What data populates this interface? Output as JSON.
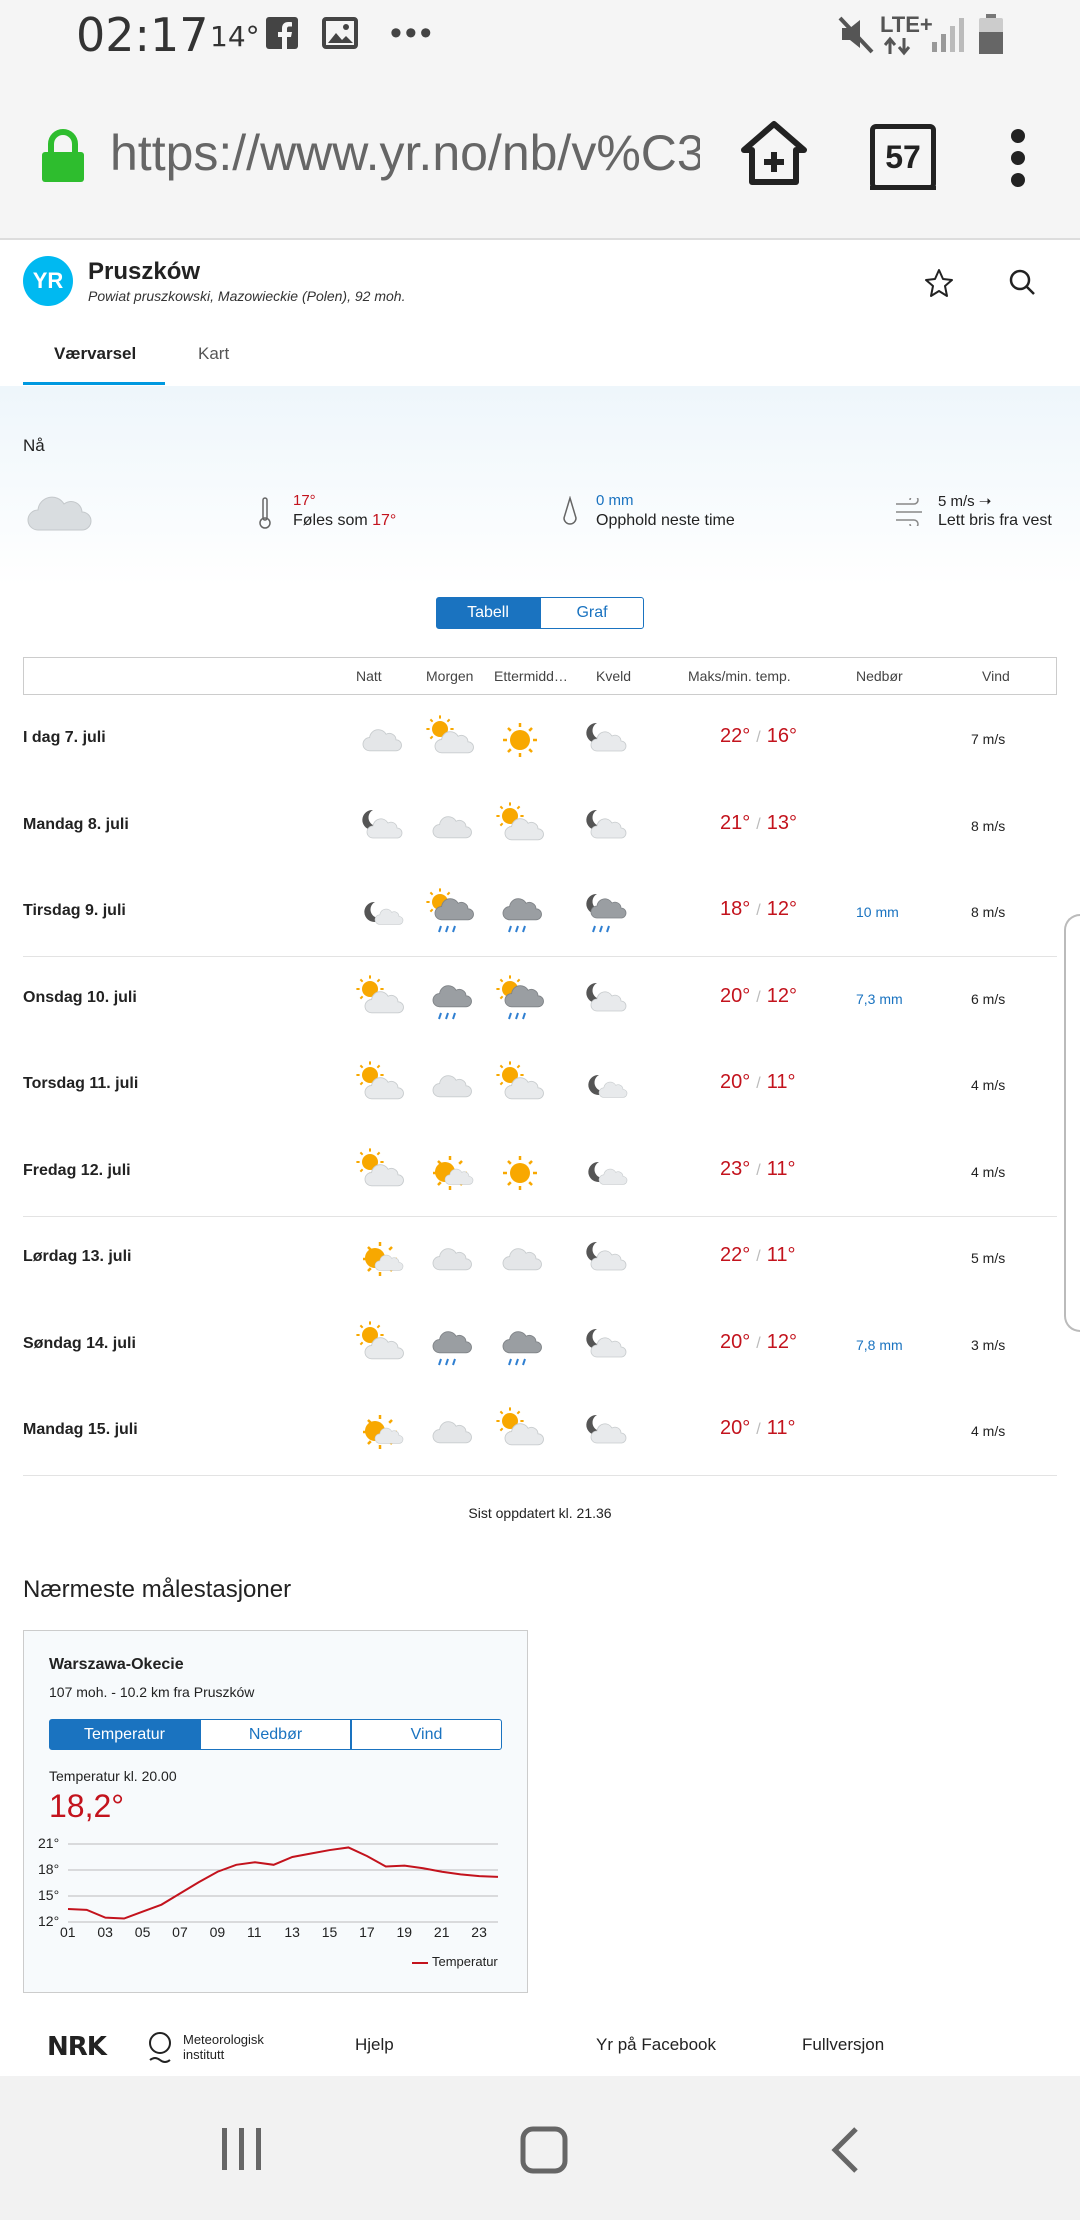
{
  "status_bar": {
    "time": "02:17",
    "temperature": "14°",
    "network": "LTE+"
  },
  "browser": {
    "url": "https://www.yr.no/nb/v%C3",
    "tab_count": "57"
  },
  "header": {
    "logo": "YR",
    "location": "Pruszków",
    "subtitle": "Powiat pruszkowski, Mazowieckie (Polen), 92 moh."
  },
  "tabs": {
    "forecast": "Værvarsel",
    "map": "Kart"
  },
  "now": {
    "label": "Nå",
    "temp": "17°",
    "feels_prefix": "Føles som",
    "feels_value": "17°",
    "precip": "0 mm",
    "precip_text": "Opphold neste time",
    "wind": "5 m/s",
    "wind_text": "Lett bris fra vest"
  },
  "view_toggle": {
    "table": "Tabell",
    "graph": "Graf",
    "selected": "Tabell"
  },
  "table": {
    "headers": {
      "night": "Natt",
      "morning": "Morgen",
      "afternoon": "Ettermidd…",
      "evening": "Kveld",
      "maxmin": "Maks/min. temp.",
      "precip": "Nedbør",
      "wind": "Vind"
    },
    "rows": [
      {
        "day": "I dag 7. juli",
        "icons": [
          "cloud",
          "partly-sunny",
          "sun",
          "moon-cloud"
        ],
        "max": "22°",
        "min": "16°",
        "precip": "",
        "wind": "7 m/s"
      },
      {
        "day": "Mandag 8. juli",
        "icons": [
          "moon-cloud",
          "cloud",
          "partly-sunny",
          "moon-cloud"
        ],
        "max": "21°",
        "min": "13°",
        "precip": "",
        "wind": "8 m/s"
      },
      {
        "day": "Tirsdag 9. juli",
        "icons": [
          "moon-partly",
          "sun-rain",
          "rain-cloud",
          "moon-rain"
        ],
        "max": "18°",
        "min": "12°",
        "precip": "10 mm",
        "wind": "8 m/s"
      },
      {
        "day": "Onsdag 10. juli",
        "icons": [
          "partly-sunny",
          "rain-cloud",
          "sun-rain",
          "moon-cloud"
        ],
        "max": "20°",
        "min": "12°",
        "precip": "7,3 mm",
        "wind": "6 m/s"
      },
      {
        "day": "Torsdag 11. juli",
        "icons": [
          "partly-sunny",
          "cloud",
          "partly-sunny",
          "moon-partly"
        ],
        "max": "20°",
        "min": "11°",
        "precip": "",
        "wind": "4 m/s"
      },
      {
        "day": "Fredag 12. juli",
        "icons": [
          "partly-sunny",
          "sun-partly",
          "sun",
          "moon-partly"
        ],
        "max": "23°",
        "min": "11°",
        "precip": "",
        "wind": "4 m/s"
      },
      {
        "day": "Lørdag 13. juli",
        "icons": [
          "sun-partly",
          "cloud",
          "cloud",
          "moon-cloud"
        ],
        "max": "22°",
        "min": "11°",
        "precip": "",
        "wind": "5 m/s"
      },
      {
        "day": "Søndag 14. juli",
        "icons": [
          "partly-sunny",
          "rain-cloud",
          "rain-cloud",
          "moon-cloud"
        ],
        "max": "20°",
        "min": "12°",
        "precip": "7,8 mm",
        "wind": "3 m/s"
      },
      {
        "day": "Mandag 15. juli",
        "icons": [
          "sun-partly",
          "cloud",
          "partly-sunny",
          "moon-cloud"
        ],
        "max": "20°",
        "min": "11°",
        "precip": "",
        "wind": "4 m/s"
      }
    ]
  },
  "updated": "Sist oppdatert kl. 21.36",
  "stations": {
    "heading": "Nærmeste målestasjoner",
    "name": "Warszawa-Okecie",
    "subtitle": "107 moh. - 10.2 km fra Pruszków",
    "tabs": [
      "Temperatur",
      "Nedbør",
      "Vind"
    ],
    "selected_tab": "Temperatur",
    "temp_label": "Temperatur kl. 20.00",
    "temp_value": "18,2°"
  },
  "chart_data": {
    "type": "line",
    "x": [
      "01",
      "02",
      "03",
      "04",
      "05",
      "06",
      "07",
      "08",
      "09",
      "10",
      "11",
      "12",
      "13",
      "14",
      "15",
      "16",
      "17",
      "18",
      "19",
      "20",
      "21",
      "22",
      "23",
      "24"
    ],
    "xticks": [
      "01",
      "03",
      "05",
      "07",
      "09",
      "11",
      "13",
      "15",
      "17",
      "19",
      "21",
      "23"
    ],
    "yticks": [
      "21°",
      "18°",
      "15°",
      "12°"
    ],
    "ylim": [
      12,
      21
    ],
    "series": [
      {
        "name": "Temperatur",
        "color": "#c3131d",
        "values": [
          13.5,
          13.4,
          12.5,
          12.4,
          13.2,
          14.0,
          15.3,
          16.6,
          17.8,
          18.6,
          18.9,
          18.6,
          19.5,
          19.9,
          20.3,
          20.6,
          19.6,
          18.4,
          18.5,
          18.2,
          17.8,
          17.5,
          17.3,
          17.2
        ]
      }
    ],
    "legend": "bottom-right"
  },
  "footer": {
    "help": "Hjelp",
    "facebook": "Yr på Facebook",
    "full": "Fullversjon",
    "logo_nrk": "NRK",
    "logo_met": "Meteorologisk institutt"
  }
}
